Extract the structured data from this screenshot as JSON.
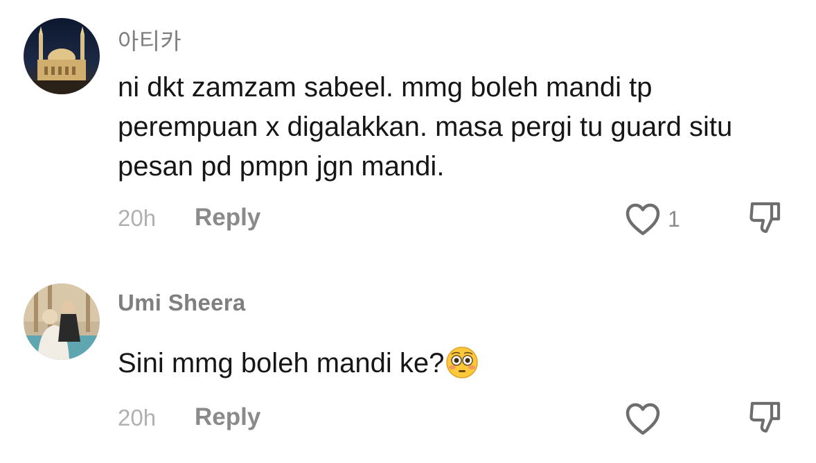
{
  "comments": [
    {
      "username": "아티카",
      "text": "ni dkt zamzam sabeel. mmg boleh mandi tp perempuan x digalakkan. masa pergi tu guard situ pesan pd pmpn jgn mandi.",
      "time": "20h",
      "reply_label": "Reply",
      "like_count": "1",
      "avatar": "mosque-at-night-photo"
    },
    {
      "username": "Umi Sheera",
      "text": "Sini mmg boleh mandi ke?",
      "emoji": "flushed-face-emoji",
      "time": "20h",
      "reply_label": "Reply",
      "like_count": "",
      "avatar": "woman-holding-child-photo"
    }
  ],
  "icons": {
    "like": "heart-outline-icon",
    "dislike": "thumbs-down-outline-icon"
  },
  "colors": {
    "text": "#161616",
    "username": "#7f7f7f",
    "meta": "#b0b0b0",
    "icon": "#6e6e6e"
  }
}
